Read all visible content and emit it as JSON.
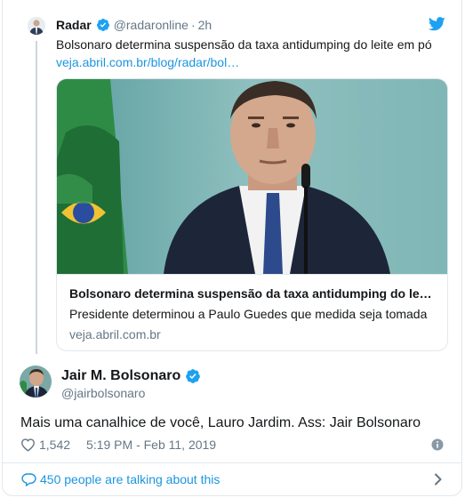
{
  "quoted_tweet": {
    "name": "Radar",
    "handle": "@radaronline",
    "separator": "·",
    "time": "2h",
    "text": "Bolsonaro determina suspensão da taxa antidumping do leite em pó",
    "link": "veja.abril.com.br/blog/radar/bol…",
    "link_card": {
      "title": "Bolsonaro determina suspensão da taxa antidumping do le…",
      "description": "Presidente determinou a Paulo Guedes que medida seja tomada",
      "domain": "veja.abril.com.br"
    }
  },
  "main_tweet": {
    "name": "Jair M. Bolsonaro",
    "handle": "@jairbolsonaro",
    "text": "Mais uma canalhice de você, Lauro Jardim. Ass: Jair Bolsonaro",
    "likes": "1,542",
    "timestamp": "5:19 PM - Feb 11, 2019"
  },
  "footer": {
    "talking_text": "450 people are talking about this"
  },
  "colors": {
    "accent": "#1b95e0",
    "verified": "#1da1f2",
    "muted": "#657786",
    "text": "#14171a",
    "border": "#e1e8ed"
  },
  "icons": [
    "verified-badge-icon",
    "twitter-bird-icon",
    "heart-icon",
    "info-icon",
    "chat-bubble-icon",
    "chevron-right-icon"
  ]
}
